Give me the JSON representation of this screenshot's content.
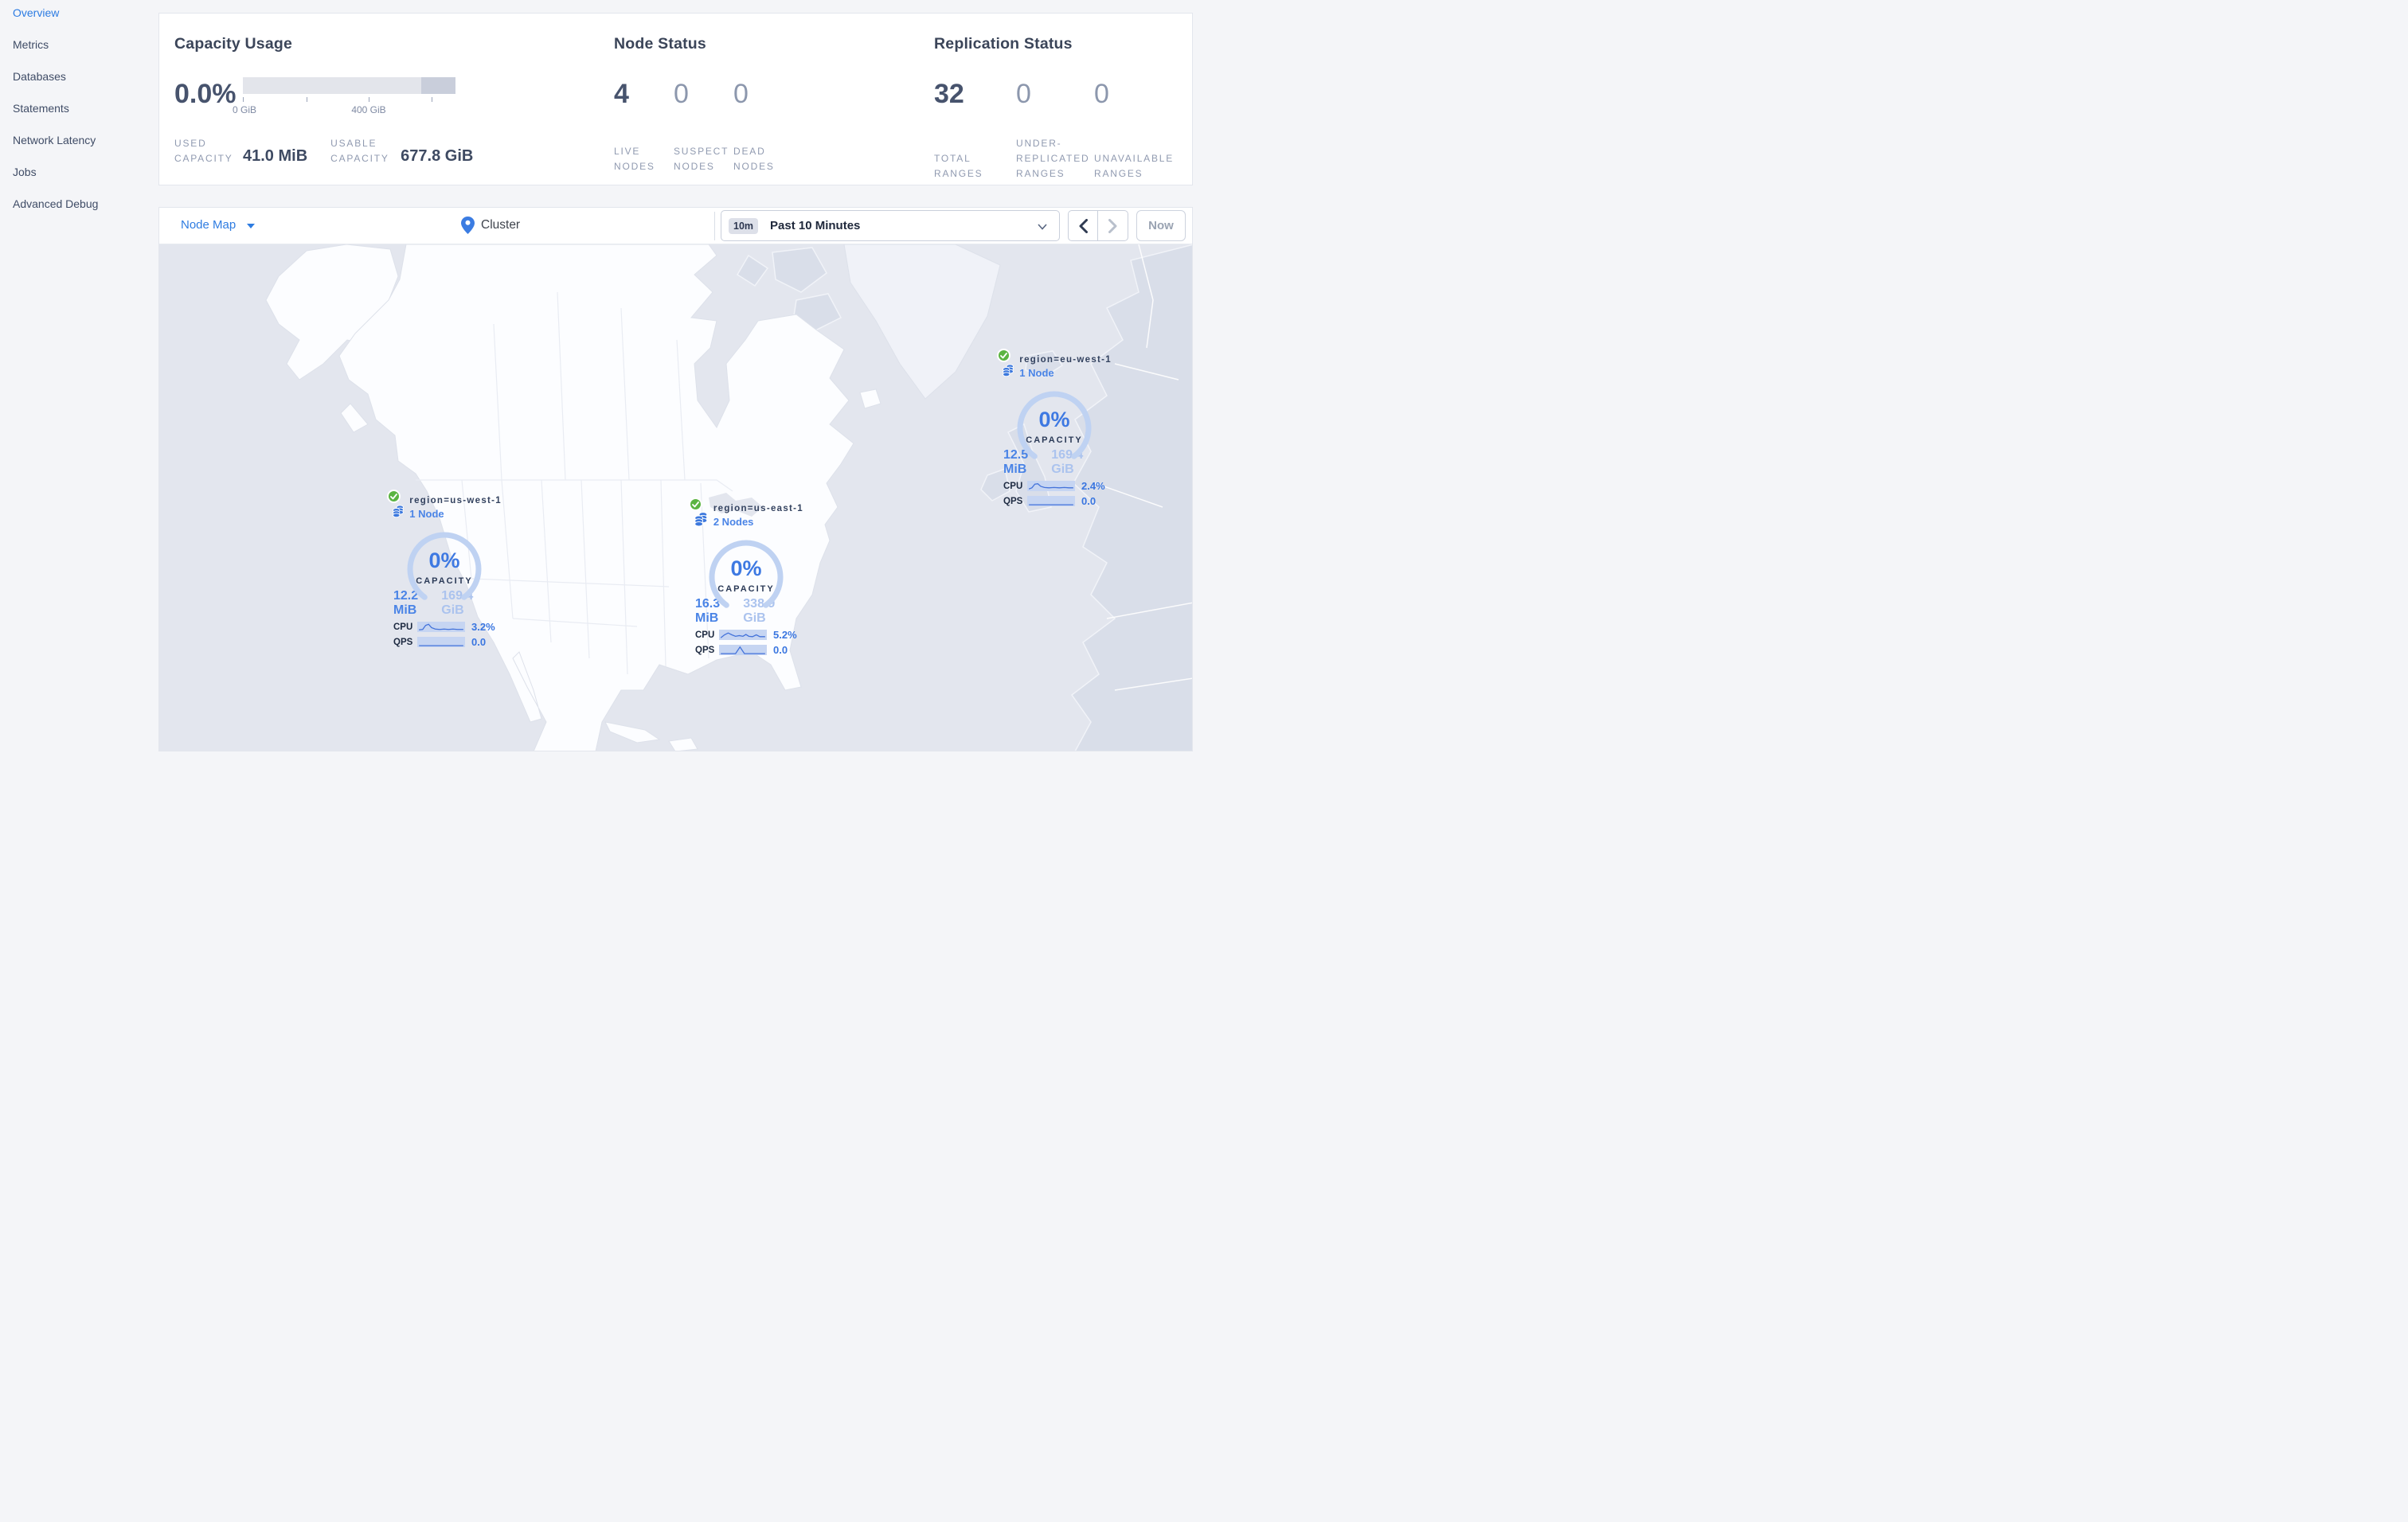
{
  "sidebar": {
    "items": [
      {
        "label": "Overview",
        "active": true
      },
      {
        "label": "Metrics",
        "active": false
      },
      {
        "label": "Databases",
        "active": false
      },
      {
        "label": "Statements",
        "active": false
      },
      {
        "label": "Network Latency",
        "active": false
      },
      {
        "label": "Jobs",
        "active": false
      },
      {
        "label": "Advanced Debug",
        "active": false
      }
    ]
  },
  "capacity_panel": {
    "title": "Capacity Usage",
    "percent": "0.0%",
    "axis_tick_labels": [
      "0 GiB",
      "400 GiB"
    ],
    "stats": [
      {
        "label": "USED CAPACITY",
        "value": "41.0 MiB"
      },
      {
        "label": "USABLE CAPACITY",
        "value": "677.8 GiB"
      }
    ]
  },
  "node_status_panel": {
    "title": "Node Status",
    "stats": [
      {
        "value": "4",
        "label": "LIVE NODES"
      },
      {
        "value": "0",
        "label": "SUSPECT NODES"
      },
      {
        "value": "0",
        "label": "DEAD NODES"
      }
    ]
  },
  "replication_panel": {
    "title": "Replication Status",
    "stats": [
      {
        "value": "32",
        "label": "TOTAL RANGES"
      },
      {
        "value": "0",
        "label": "UNDER-REPLICATED RANGES"
      },
      {
        "value": "0",
        "label": "UNAVAILABLE RANGES"
      }
    ]
  },
  "toolbar": {
    "view_selector": "Node Map",
    "breadcrumb": "Cluster",
    "time_badge": "10m",
    "time_range": "Past 10 Minutes",
    "now_label": "Now"
  },
  "map": {
    "regions": [
      {
        "name": "region=us-west-1",
        "nodes": "1 Node",
        "capacity_percent": "0%",
        "capacity_label": "CAPACITY",
        "used": "12.2 MiB",
        "total": "169.4 GiB",
        "cpu_label": "CPU",
        "cpu": "3.2%",
        "qps_label": "QPS",
        "qps": "0.0",
        "cpu_spark": "0,11 5,10.5 9,5 13,3.5 17,8 22,10 28,10.5 34,10 40,10.5 46,10 52,10.5 60,10.5",
        "qps_spark": "0,12 60,12"
      },
      {
        "name": "region=us-east-1",
        "nodes": "2 Nodes",
        "capacity_percent": "0%",
        "capacity_label": "CAPACITY",
        "used": "16.3 MiB",
        "total": "338.9 GiB",
        "cpu_label": "CPU",
        "cpu": "5.2%",
        "qps_label": "QPS",
        "qps": "0.0",
        "cpu_spark": "0,11 5,7 10,4.5 15,7 20,9 25,8 30,9 34,6.5 38,9 43,9.5 48,7 53,9.5 60,9.5",
        "qps_spark": "0,12 20,12 26,3 32,12 60,12"
      },
      {
        "name": "region=eu-west-1",
        "nodes": "1 Node",
        "capacity_percent": "0%",
        "capacity_label": "CAPACITY",
        "used": "12.5 MiB",
        "total": "169.4 GiB",
        "cpu_label": "CPU",
        "cpu": "2.4%",
        "qps_label": "QPS",
        "qps": "0.0",
        "cpu_spark": "0,11 4,9.5 8,4.5 12,4 16,7.5 21,9 27,9.5 34,9 41,9.5 48,9 54,9.5 60,9.5",
        "qps_spark": "0,12 60,12"
      }
    ]
  },
  "colors": {
    "accent_blue": "#2e7ce1",
    "marker_blue": "#3c78dd",
    "value_blue": "#3d78e0",
    "light_value_blue": "#abc3ee",
    "gauge_arc": "#bfd2f2",
    "status_green": "#5bb442",
    "heading_slate": "#3b4559",
    "number_dark": "#47536d",
    "number_dim": "#8c97ad",
    "label_gray": "#909ab0",
    "ocean": "#e3e6ee",
    "land_white": "#fcfdff",
    "land_gray": "#d9dee9",
    "page_bg": "#f4f5f8"
  }
}
